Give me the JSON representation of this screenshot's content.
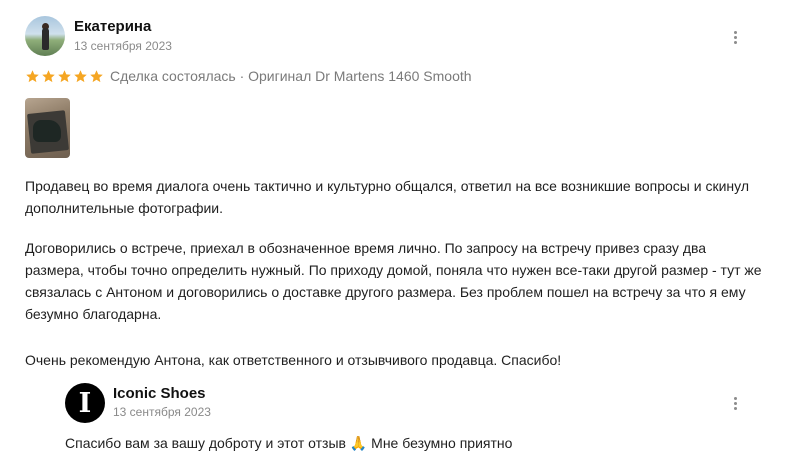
{
  "review": {
    "author": "Екатерина",
    "date": "13 сентября 2023",
    "rating": 5,
    "rating_max": 5,
    "star_color": "#f5a623",
    "meta": "Сделка состоялась · Оригинал Dr Martens 1460 Smooth",
    "paragraphs": [
      "Продавец во время диалога очень тактично и культурно общался, ответил на все возникшие вопросы и скинул дополнительные фотографии.",
      "Договорились о встрече, приехал в обозначенное время лично. По запросу на встречу привез сразу два размера, чтобы точно определить нужный. По приходу домой, поняла что нужен все-таки другой размер - тут же связалась с Антоном и договорились о доставке другого размера. Без проблем пошел на встречу за что я ему безумно благодарна.",
      "Очень рекомендую Антона, как ответственного и отзывчивого продавца. Спасибо!"
    ]
  },
  "reply": {
    "author": "Iconic Shoes",
    "avatar_letter": "I",
    "date": "13 сентября 2023",
    "text": "Спасибо вам за вашу доброту и этот отзыв 🙏 Мне безумно приятно"
  }
}
